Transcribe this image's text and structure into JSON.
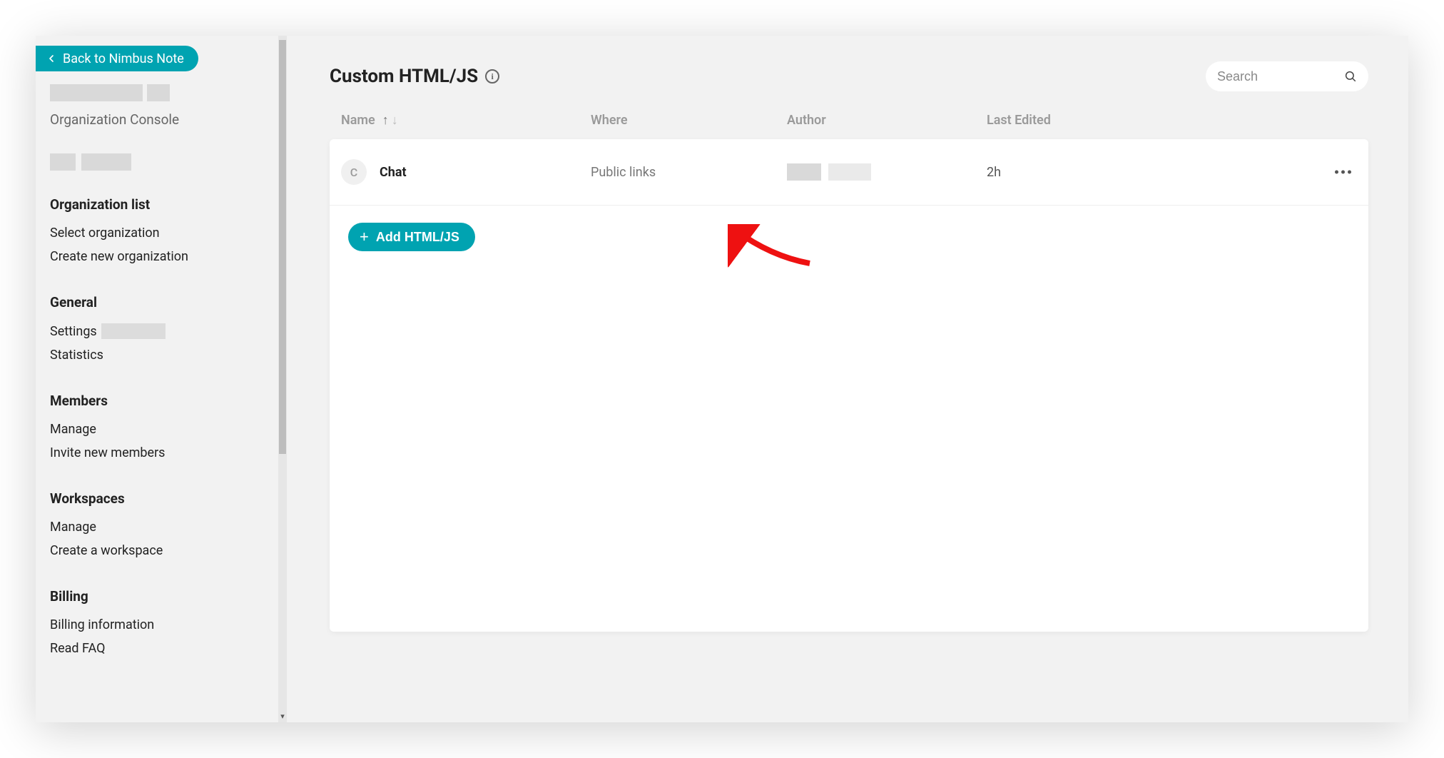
{
  "back_label": "Back to Nimbus Note",
  "console_label": "Organization Console",
  "page_title": "Custom HTML/JS",
  "search": {
    "placeholder": "Search"
  },
  "columns": {
    "name": "Name",
    "where": "Where",
    "author": "Author",
    "last_edited": "Last Edited"
  },
  "row": {
    "initial": "C",
    "name": "Chat",
    "where": "Public links",
    "last_edited": "2h"
  },
  "add_button": "Add HTML/JS",
  "sidebar": {
    "sections": {
      "org": {
        "heading": "Organization list",
        "items": [
          "Select organization",
          "Create new organization"
        ]
      },
      "general": {
        "heading": "General",
        "items": [
          "Settings",
          "Statistics"
        ]
      },
      "members": {
        "heading": "Members",
        "items": [
          "Manage",
          "Invite new members"
        ]
      },
      "workspaces": {
        "heading": "Workspaces",
        "items": [
          "Manage",
          "Create a workspace"
        ]
      },
      "billing": {
        "heading": "Billing",
        "items": [
          "Billing information",
          "Read FAQ"
        ]
      }
    }
  }
}
